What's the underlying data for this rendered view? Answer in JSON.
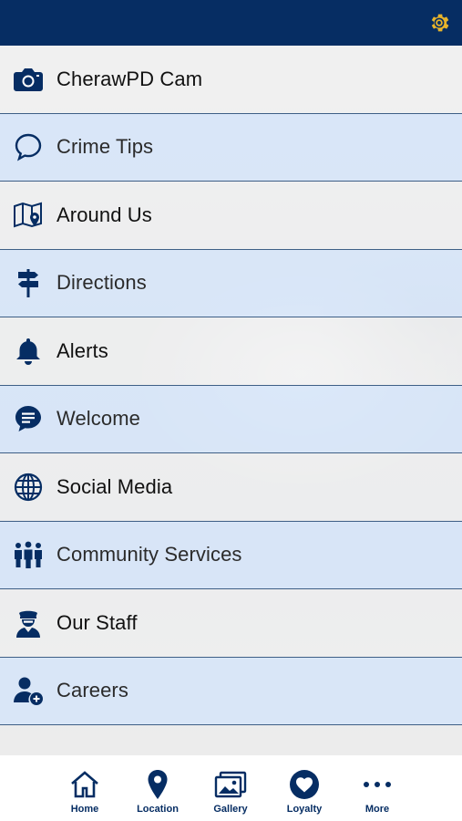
{
  "colors": {
    "brand": "#062d63",
    "gear": "#e8b42a",
    "row_alt": "#d3e4fa",
    "row_divider": "#3e5f86"
  },
  "header": {
    "settings_icon": "gear-icon"
  },
  "menu": {
    "items": [
      {
        "label": "CherawPD Cam",
        "icon": "camera-icon"
      },
      {
        "label": "Crime Tips",
        "icon": "speech-bubble-icon"
      },
      {
        "label": "Around Us",
        "icon": "map-pin-icon"
      },
      {
        "label": "Directions",
        "icon": "signpost-icon"
      },
      {
        "label": "Alerts",
        "icon": "bell-icon"
      },
      {
        "label": "Welcome",
        "icon": "chat-icon"
      },
      {
        "label": "Social Media",
        "icon": "globe-icon"
      },
      {
        "label": "Community Services",
        "icon": "people-icon"
      },
      {
        "label": "Our Staff",
        "icon": "officer-icon"
      },
      {
        "label": "Careers",
        "icon": "add-user-icon"
      }
    ]
  },
  "tabbar": {
    "tabs": [
      {
        "label": "Home",
        "icon": "home-icon"
      },
      {
        "label": "Location",
        "icon": "location-pin-icon"
      },
      {
        "label": "Gallery",
        "icon": "gallery-icon"
      },
      {
        "label": "Loyalty",
        "icon": "heart-icon"
      },
      {
        "label": "More",
        "icon": "more-icon"
      }
    ]
  }
}
